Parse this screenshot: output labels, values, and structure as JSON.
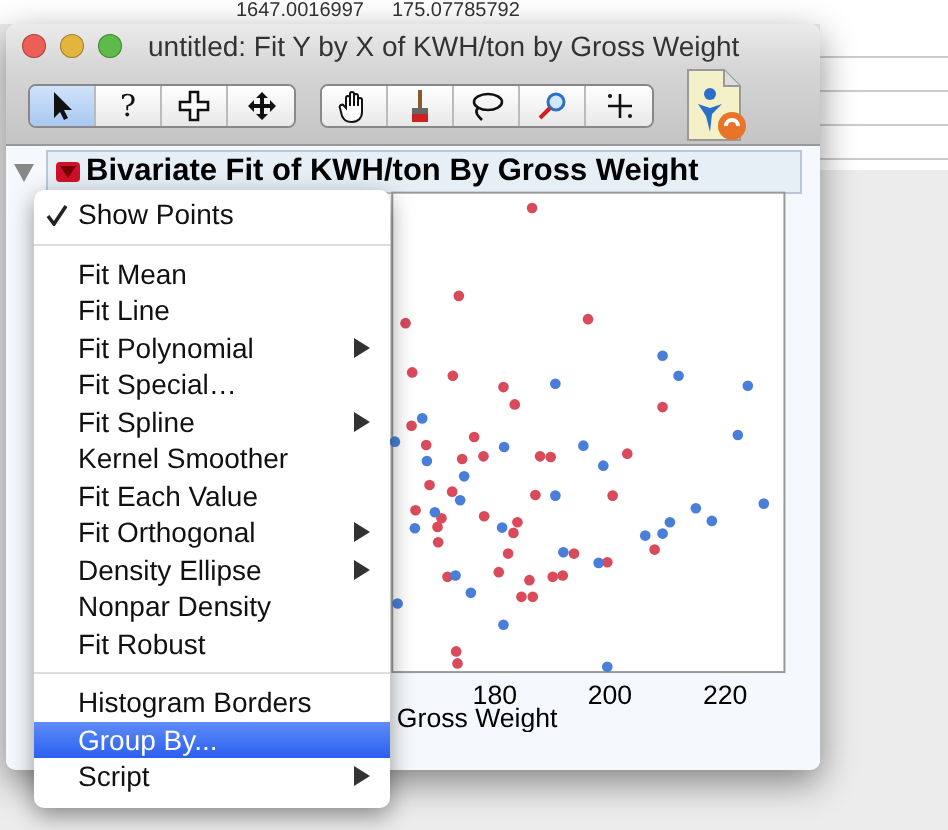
{
  "background_table": {
    "cells": [
      "1647.0016997",
      "175.07785792"
    ]
  },
  "window": {
    "title": "untitled: Fit Y by X of KWH/ton by Gross Weight"
  },
  "toolbar": {
    "groups": [
      [
        {
          "kind": "arrow",
          "selected": true
        },
        {
          "kind": "text",
          "text": "?",
          "selected": false
        },
        {
          "kind": "crosshair",
          "selected": false
        },
        {
          "kind": "move",
          "selected": false
        }
      ],
      [
        {
          "kind": "hand",
          "selected": false
        },
        {
          "kind": "brush",
          "selected": false
        },
        {
          "kind": "lasso",
          "selected": false
        },
        {
          "kind": "magnifier",
          "selected": false
        },
        {
          "kind": "crosshair-xy",
          "selected": false
        }
      ]
    ]
  },
  "report": {
    "title": "Bivariate Fit of KWH/ton By Gross Weight",
    "expanded": true,
    "plot": {
      "x_ticks": [
        "180",
        "200",
        "220"
      ],
      "x_label": "Gross Weight"
    }
  },
  "menu": {
    "items": [
      {
        "kind": "item",
        "label": "Show Points",
        "checked": true,
        "submenu": false,
        "selected": false
      },
      {
        "kind": "separator"
      },
      {
        "kind": "item",
        "label": "Fit Mean",
        "checked": false,
        "submenu": false,
        "selected": false
      },
      {
        "kind": "item",
        "label": "Fit Line",
        "checked": false,
        "submenu": false,
        "selected": false
      },
      {
        "kind": "item",
        "label": "Fit Polynomial",
        "checked": false,
        "submenu": true,
        "selected": false
      },
      {
        "kind": "item",
        "label": "Fit Special…",
        "checked": false,
        "submenu": false,
        "selected": false
      },
      {
        "kind": "item",
        "label": "Fit Spline",
        "checked": false,
        "submenu": true,
        "selected": false
      },
      {
        "kind": "item",
        "label": "Kernel Smoother",
        "checked": false,
        "submenu": false,
        "selected": false
      },
      {
        "kind": "item",
        "label": "Fit Each Value",
        "checked": false,
        "submenu": false,
        "selected": false
      },
      {
        "kind": "item",
        "label": "Fit Orthogonal",
        "checked": false,
        "submenu": true,
        "selected": false
      },
      {
        "kind": "item",
        "label": "Density Ellipse",
        "checked": false,
        "submenu": true,
        "selected": false
      },
      {
        "kind": "item",
        "label": "Nonpar Density",
        "checked": false,
        "submenu": false,
        "selected": false
      },
      {
        "kind": "item",
        "label": "Fit Robust",
        "checked": false,
        "submenu": false,
        "selected": false
      },
      {
        "kind": "separator"
      },
      {
        "kind": "item",
        "label": "Histogram Borders",
        "checked": false,
        "submenu": false,
        "selected": false
      },
      {
        "kind": "item",
        "label": "Group By...",
        "checked": false,
        "submenu": false,
        "selected": true
      },
      {
        "kind": "item",
        "label": "Script",
        "checked": false,
        "submenu": true,
        "selected": false
      }
    ]
  }
}
